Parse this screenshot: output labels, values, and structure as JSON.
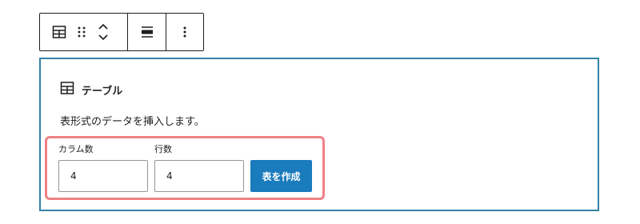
{
  "toolbar": {
    "icons": [
      "table-icon",
      "drag-handle-icon",
      "move-up-down-icon",
      "align-icon",
      "more-options-icon"
    ]
  },
  "block": {
    "title": "テーブル",
    "description": "表形式のデータを挿入します。",
    "columns_label": "カラム数",
    "columns_value": "4",
    "rows_label": "行数",
    "rows_value": "4",
    "create_button_label": "表を作成"
  },
  "colors": {
    "block_border": "#3582a5",
    "highlight": "#f08085",
    "primary_button": "#1a7bbd"
  }
}
